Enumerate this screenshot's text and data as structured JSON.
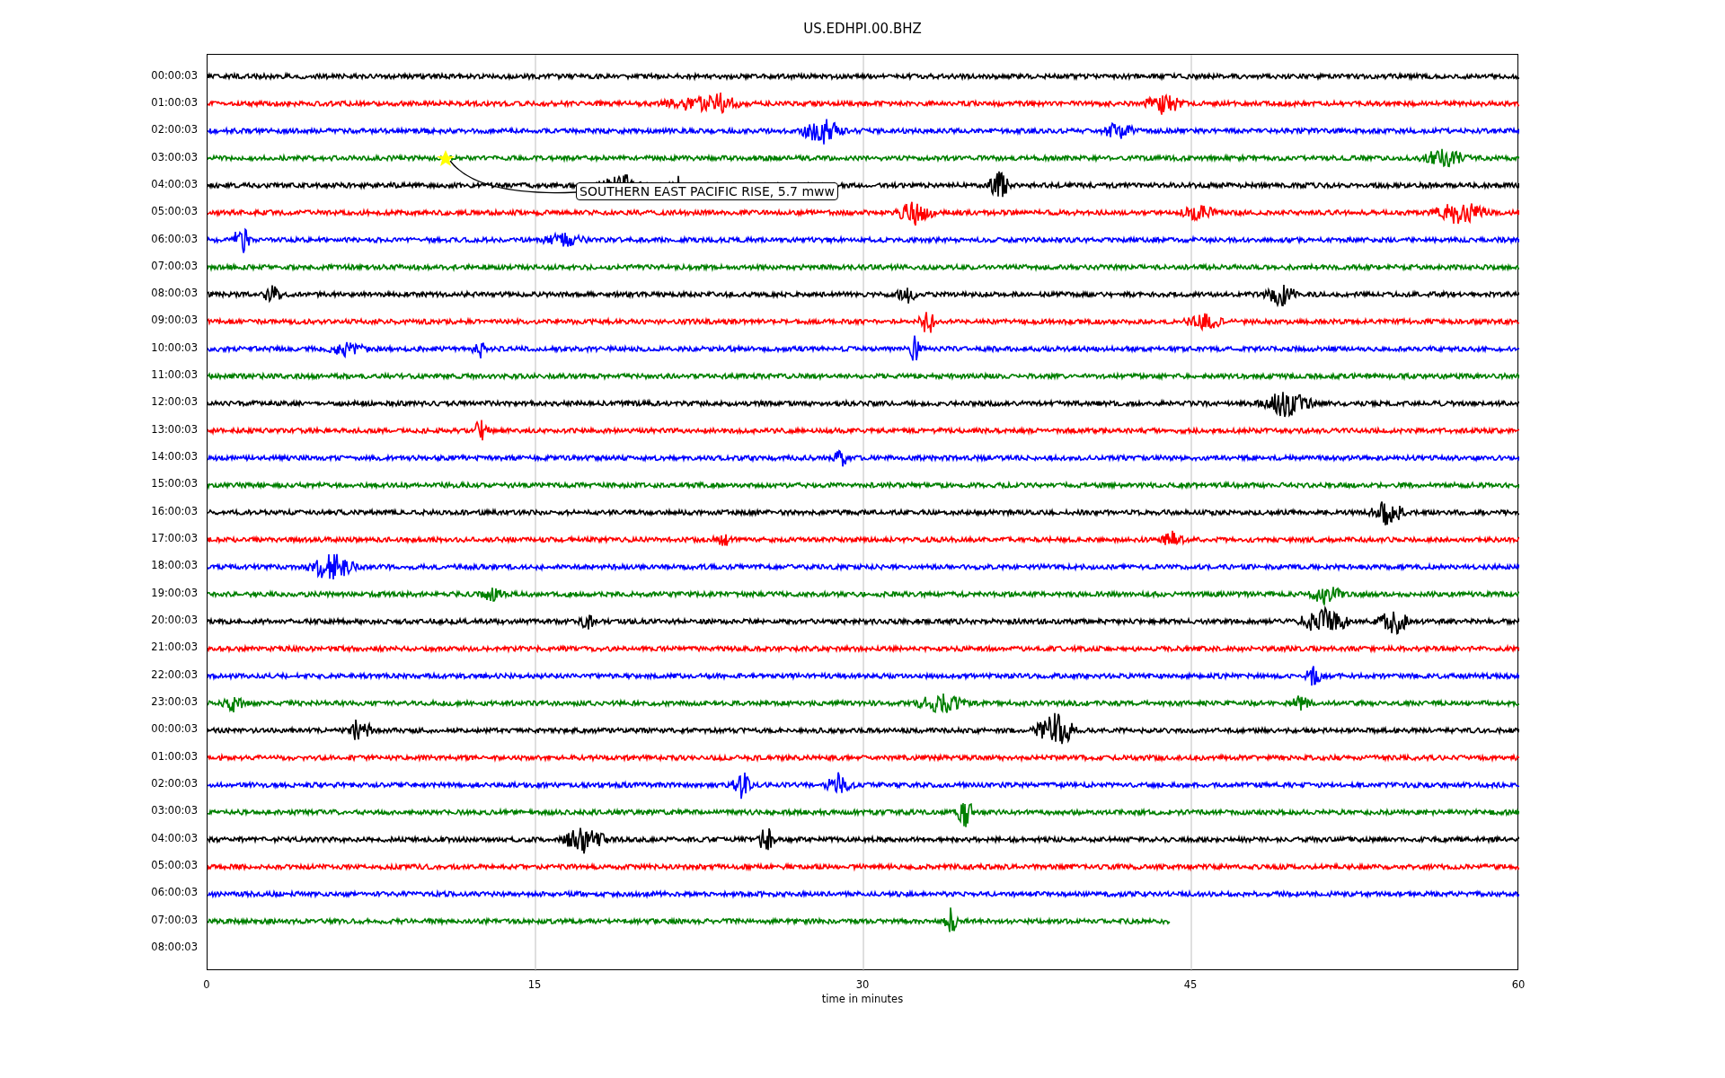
{
  "title": "US.EDHPI.00.BHZ",
  "traces": [
    {
      "label": "00:00:03",
      "color": "#000000",
      "kind": "full"
    },
    {
      "label": "01:00:03",
      "color": "#ff0000",
      "kind": "full"
    },
    {
      "label": "02:00:03",
      "color": "#0000ff",
      "kind": "full"
    },
    {
      "label": "03:00:03",
      "color": "#008000",
      "kind": "full"
    },
    {
      "label": "04:00:03",
      "color": "#000000",
      "kind": "full"
    },
    {
      "label": "05:00:03",
      "color": "#ff0000",
      "kind": "full"
    },
    {
      "label": "06:00:03",
      "color": "#0000ff",
      "kind": "full"
    },
    {
      "label": "07:00:03",
      "color": "#008000",
      "kind": "full"
    },
    {
      "label": "08:00:03",
      "color": "#000000",
      "kind": "full"
    },
    {
      "label": "09:00:03",
      "color": "#ff0000",
      "kind": "full"
    },
    {
      "label": "10:00:03",
      "color": "#0000ff",
      "kind": "full"
    },
    {
      "label": "11:00:03",
      "color": "#008000",
      "kind": "full"
    },
    {
      "label": "12:00:03",
      "color": "#000000",
      "kind": "full"
    },
    {
      "label": "13:00:03",
      "color": "#ff0000",
      "kind": "full"
    },
    {
      "label": "14:00:03",
      "color": "#0000ff",
      "kind": "full"
    },
    {
      "label": "15:00:03",
      "color": "#008000",
      "kind": "full"
    },
    {
      "label": "16:00:03",
      "color": "#000000",
      "kind": "full"
    },
    {
      "label": "17:00:03",
      "color": "#ff0000",
      "kind": "full"
    },
    {
      "label": "18:00:03",
      "color": "#0000ff",
      "kind": "full"
    },
    {
      "label": "19:00:03",
      "color": "#008000",
      "kind": "full"
    },
    {
      "label": "20:00:03",
      "color": "#000000",
      "kind": "full"
    },
    {
      "label": "21:00:03",
      "color": "#ff0000",
      "kind": "full"
    },
    {
      "label": "22:00:03",
      "color": "#0000ff",
      "kind": "full"
    },
    {
      "label": "23:00:03",
      "color": "#008000",
      "kind": "full"
    },
    {
      "label": "00:00:03",
      "color": "#000000",
      "kind": "full"
    },
    {
      "label": "01:00:03",
      "color": "#ff0000",
      "kind": "full"
    },
    {
      "label": "02:00:03",
      "color": "#0000ff",
      "kind": "full"
    },
    {
      "label": "03:00:03",
      "color": "#008000",
      "kind": "full"
    },
    {
      "label": "04:00:03",
      "color": "#000000",
      "kind": "full"
    },
    {
      "label": "05:00:03",
      "color": "#ff0000",
      "kind": "full"
    },
    {
      "label": "06:00:03",
      "color": "#0000ff",
      "kind": "full"
    },
    {
      "label": "07:00:03",
      "color": "#008000",
      "kind": "partial"
    },
    {
      "label": "08:00:03",
      "kind": "empty"
    }
  ],
  "x_axis": {
    "ticks": [
      "0",
      "15",
      "30",
      "45",
      "60"
    ],
    "label": "time in minutes"
  },
  "event": {
    "label": "SOUTHERN EAST PACIFIC RISE, 5.7 mww"
  }
}
